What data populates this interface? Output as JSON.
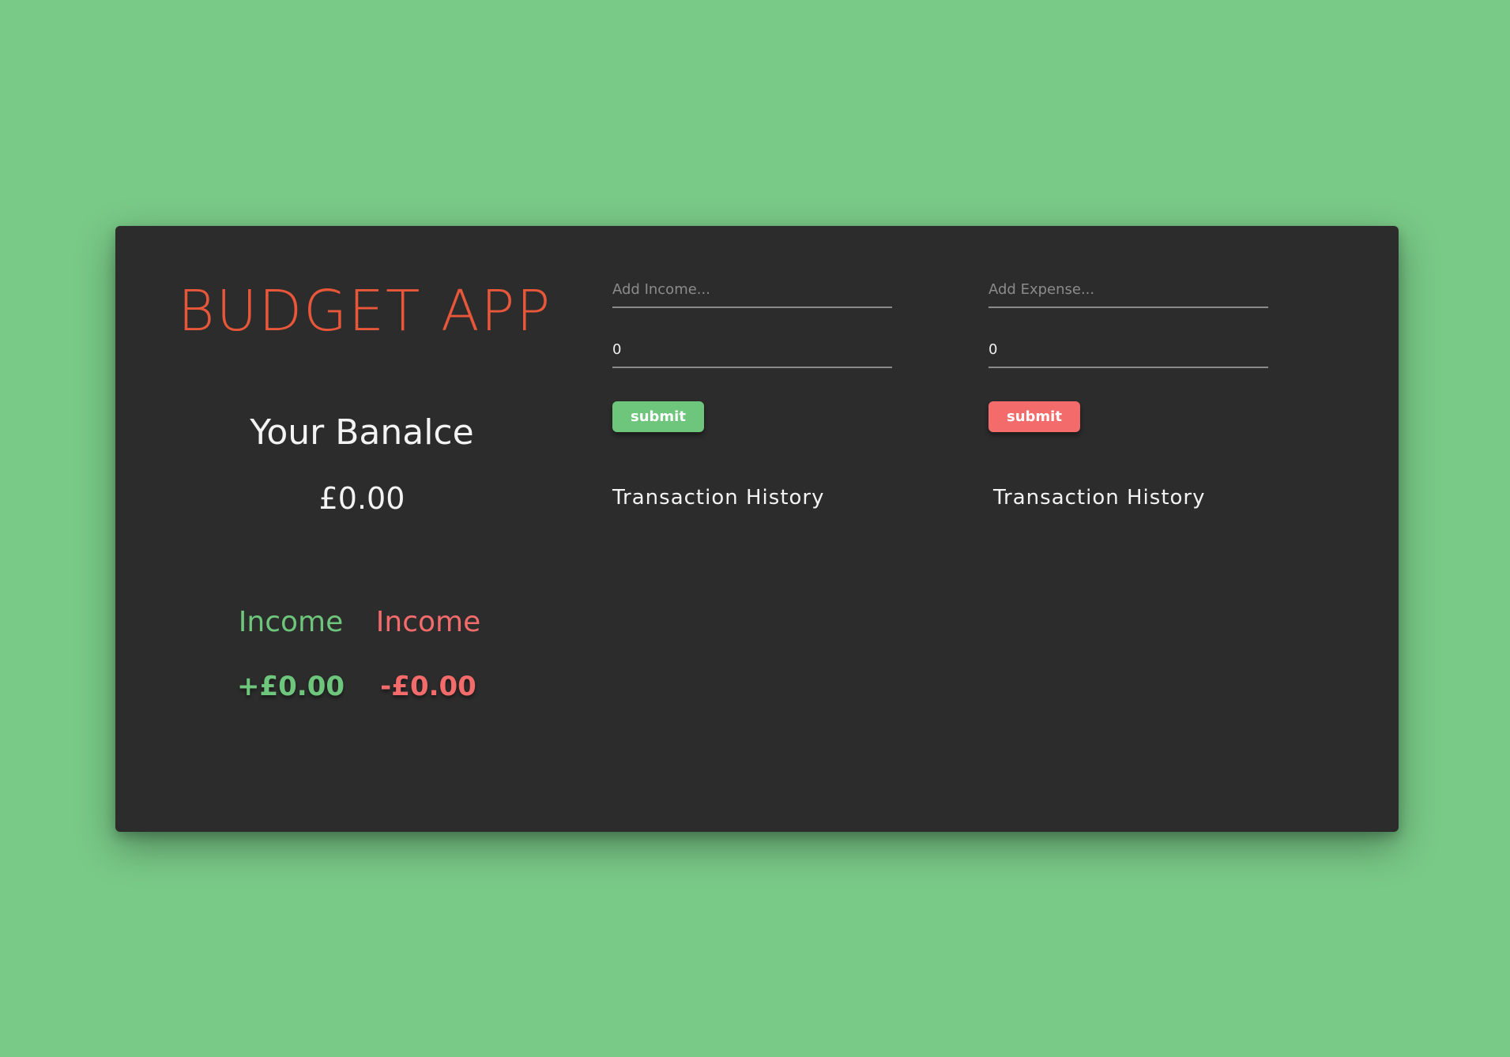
{
  "app": {
    "title": "BUDGET APP"
  },
  "balance": {
    "label": "Your Banalce",
    "amount": "£0.00"
  },
  "summary": {
    "income": {
      "label": "Income",
      "value": "+£0.00"
    },
    "expense": {
      "label": "Income",
      "value": "-£0.00"
    }
  },
  "income_form": {
    "description_placeholder": "Add Income...",
    "amount_value": "0",
    "submit_label": "submit",
    "history_title": "Transaction History"
  },
  "expense_form": {
    "description_placeholder": "Add Expense...",
    "amount_value": "0",
    "submit_label": "submit",
    "history_title": "Transaction History"
  },
  "colors": {
    "background": "#79c987",
    "card": "#2c2c2c",
    "title": "#e8573a",
    "income": "#6ec57c",
    "expense": "#f36b6b"
  }
}
